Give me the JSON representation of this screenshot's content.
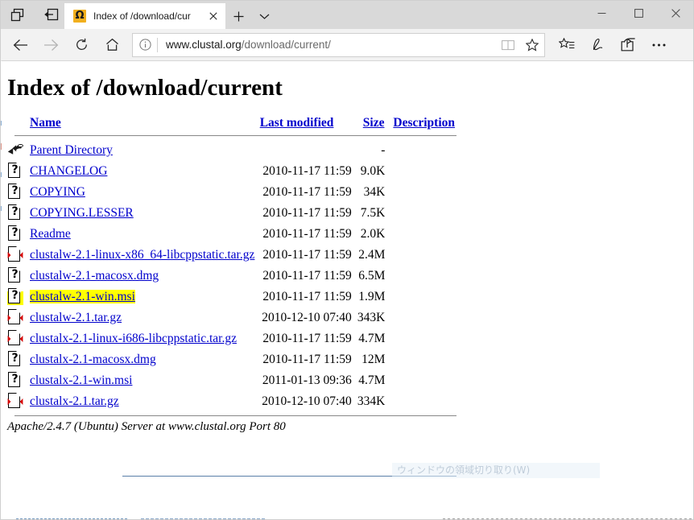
{
  "window": {
    "titlebar_buttons": [
      {
        "name": "tab-preview-icon",
        "label": "Tab preview"
      },
      {
        "name": "set-tabs-aside-icon",
        "label": "Set these tabs aside"
      }
    ],
    "controls": {
      "minimize": "–",
      "maximize": "□",
      "close": "✕"
    }
  },
  "tab": {
    "favicon_glyph": "Ω",
    "favicon_color": "#f2b01e",
    "title": "Index of /download/cur",
    "close_glyph": "✕",
    "new_tab_glyph": "+",
    "tab_menu_glyph": "⌄"
  },
  "navbar": {
    "back_label": "Back",
    "forward_label": "Forward",
    "refresh_label": "Refresh",
    "home_label": "Home",
    "address": {
      "host": "www.clustal.org",
      "path": "/download/current/",
      "full": "www.clustal.org/download/current/",
      "info_icon": "info-icon",
      "reading_view_icon": "reading-view-icon",
      "favorite_icon": "star-icon"
    },
    "tools": [
      {
        "name": "favorites-hub-icon",
        "label": "Favorites and Hub"
      },
      {
        "name": "web-notes-icon",
        "label": "Make a Web Note"
      },
      {
        "name": "share-icon",
        "label": "Share"
      },
      {
        "name": "more-icon",
        "label": "Settings and more"
      }
    ]
  },
  "page": {
    "title": "Index of /download/current",
    "columns": [
      {
        "key": "name",
        "label": "Name"
      },
      {
        "key": "modified",
        "label": "Last modified"
      },
      {
        "key": "size",
        "label": "Size"
      },
      {
        "key": "description",
        "label": "Description"
      }
    ],
    "parent": {
      "icon": "back-arrow-icon",
      "name": "Parent Directory",
      "modified": "",
      "size": "-",
      "description": ""
    },
    "rows": [
      {
        "icon": "unknown-file-icon",
        "name": "CHANGELOG",
        "modified": "2010-11-17 11:59",
        "size": "9.0K",
        "description": "",
        "highlighted": false
      },
      {
        "icon": "unknown-file-icon",
        "name": "COPYING",
        "modified": "2010-11-17 11:59",
        "size": "34K",
        "description": "",
        "highlighted": false
      },
      {
        "icon": "unknown-file-icon",
        "name": "COPYING.LESSER",
        "modified": "2010-11-17 11:59",
        "size": "7.5K",
        "description": "",
        "highlighted": false
      },
      {
        "icon": "unknown-file-icon",
        "name": "Readme",
        "modified": "2010-11-17 11:59",
        "size": "2.0K",
        "description": "",
        "highlighted": false
      },
      {
        "icon": "compressed-file-icon",
        "name": "clustalw-2.1-linux-x86_64-libcppstatic.tar.gz",
        "modified": "2010-11-17 11:59",
        "size": "2.4M",
        "description": "",
        "highlighted": false
      },
      {
        "icon": "unknown-file-icon",
        "name": "clustalw-2.1-macosx.dmg",
        "modified": "2010-11-17 11:59",
        "size": "6.5M",
        "description": "",
        "highlighted": false
      },
      {
        "icon": "unknown-file-icon",
        "name": "clustalw-2.1-win.msi",
        "modified": "2010-11-17 11:59",
        "size": "1.9M",
        "description": "",
        "highlighted": true
      },
      {
        "icon": "compressed-file-icon",
        "name": "clustalw-2.1.tar.gz",
        "modified": "2010-12-10 07:40",
        "size": "343K",
        "description": "",
        "highlighted": false
      },
      {
        "icon": "compressed-file-icon",
        "name": "clustalx-2.1-linux-i686-libcppstatic.tar.gz",
        "modified": "2010-11-17 11:59",
        "size": "4.7M",
        "description": "",
        "highlighted": false
      },
      {
        "icon": "unknown-file-icon",
        "name": "clustalx-2.1-macosx.dmg",
        "modified": "2010-11-17 11:59",
        "size": "12M",
        "description": "",
        "highlighted": false
      },
      {
        "icon": "unknown-file-icon",
        "name": "clustalx-2.1-win.msi",
        "modified": "2011-01-13 09:36",
        "size": "4.7M",
        "description": "",
        "highlighted": false
      },
      {
        "icon": "compressed-file-icon",
        "name": "clustalx-2.1.tar.gz",
        "modified": "2010-12-10 07:40",
        "size": "334K",
        "description": "",
        "highlighted": false
      }
    ],
    "footer": "Apache/2.4.7 (Ubuntu) Server at www.clustal.org Port 80",
    "highlight_color": "#ffff00",
    "link_color": "#0000cc"
  },
  "overlay": {
    "ghost_text": "ウィンドウの領域切り取り(W)"
  }
}
